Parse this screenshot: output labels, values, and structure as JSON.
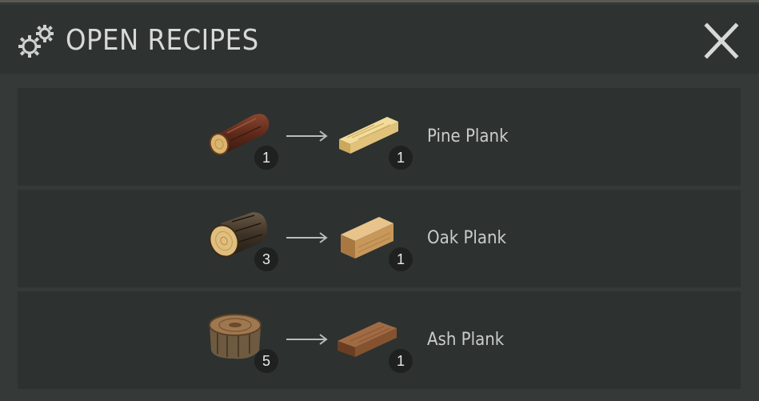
{
  "window": {
    "title": "OPEN RECIPES"
  },
  "recipes": [
    {
      "input_icon": "pine-log-icon",
      "input_qty": "1",
      "output_icon": "pine-plank-icon",
      "output_qty": "1",
      "name": "Pine Plank"
    },
    {
      "input_icon": "oak-log-icon",
      "input_qty": "3",
      "output_icon": "oak-plank-icon",
      "output_qty": "1",
      "name": "Oak Plank"
    },
    {
      "input_icon": "ash-stump-icon",
      "input_qty": "5",
      "output_icon": "ash-plank-icon",
      "output_qty": "1",
      "name": "Ash Plank"
    }
  ],
  "colors": {
    "background": "#353938",
    "titlebar": "#2e3231",
    "row": "#2d3130",
    "badge": "#1e2120",
    "text": "#d6d9d8"
  }
}
